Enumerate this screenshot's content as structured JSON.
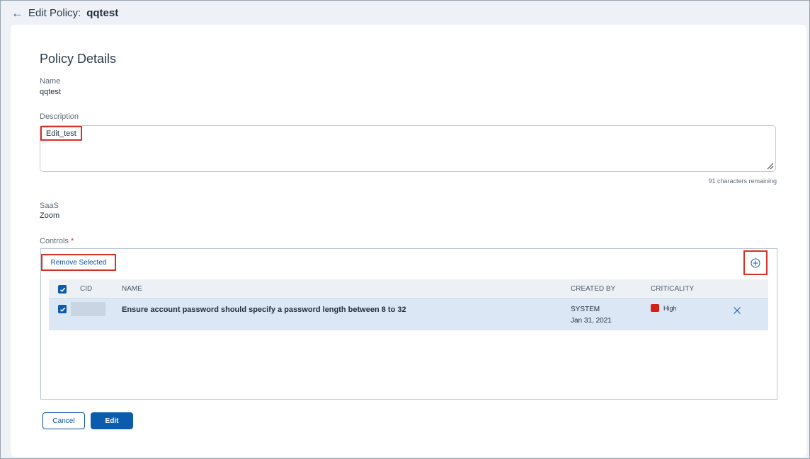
{
  "header": {
    "back_icon": "arrow-left-icon",
    "title_prefix": "Edit Policy:",
    "policy_name": "qqtest"
  },
  "section_title": "Policy Details",
  "fields": {
    "name_label": "Name",
    "name_value": "qqtest",
    "description_label": "Description",
    "description_value": "Edit_test",
    "chars_remaining": "91 characters remaining",
    "saas_label": "SaaS",
    "saas_value": "Zoom",
    "controls_label": "Controls",
    "required_marker": "*"
  },
  "controls": {
    "remove_selected_label": "Remove Selected",
    "add_icon": "plus-circle-icon",
    "columns": {
      "cid": "CID",
      "name": "NAME",
      "created_by": "CREATED BY",
      "criticality": "CRITICALITY"
    },
    "rows": [
      {
        "checked": true,
        "name": "Ensure account password should specify a password length between 8 to 32",
        "created_by": "SYSTEM",
        "created_date": "Jan 31, 2021",
        "criticality": "High",
        "criticality_color": "#d32013"
      }
    ]
  },
  "actions": {
    "cancel_label": "Cancel",
    "edit_label": "Edit"
  },
  "colors": {
    "accent": "#0b5cad",
    "highlight_border": "#d93025"
  }
}
